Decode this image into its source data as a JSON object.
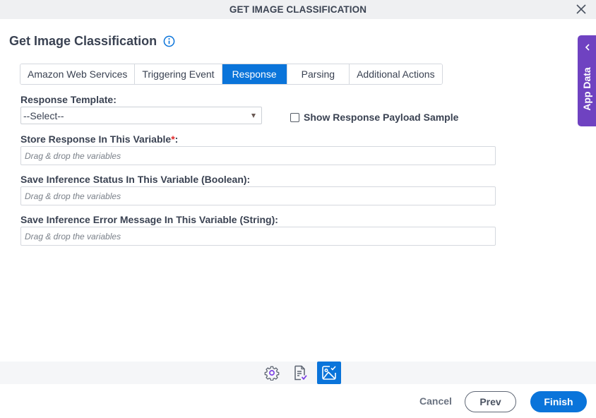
{
  "window": {
    "title": "GET IMAGE CLASSIFICATION",
    "close_icon": "close-icon"
  },
  "heading": {
    "title": "Get Image Classification",
    "info_icon": "info-circle-icon"
  },
  "tabs": [
    {
      "label": "Amazon Web Services",
      "active": false
    },
    {
      "label": "Triggering Event",
      "active": false
    },
    {
      "label": "Response",
      "active": true
    },
    {
      "label": "Parsing",
      "active": false
    },
    {
      "label": "Additional Actions",
      "active": false
    }
  ],
  "form": {
    "response_template": {
      "label": "Response Template:",
      "value": "--Select--"
    },
    "show_payload": {
      "label": "Show Response Payload Sample",
      "checked": false
    },
    "store_response": {
      "label": "Store Response In This Variable",
      "required_mark": "*",
      "suffix": ":",
      "placeholder": "Drag & drop the variables"
    },
    "inference_status": {
      "label": "Save Inference Status In This Variable (Boolean):",
      "placeholder": "Drag & drop the variables"
    },
    "inference_error": {
      "label": "Save Inference Error Message In This Variable (String):",
      "placeholder": "Drag & drop the variables"
    }
  },
  "side_panel": {
    "label": "App Data",
    "icon": "chevron-left-icon"
  },
  "icon_bar": [
    {
      "name": "settings-gear-icon",
      "active": false
    },
    {
      "name": "document-check-icon",
      "active": false
    },
    {
      "name": "image-classification-icon",
      "active": true
    }
  ],
  "footer": {
    "cancel": "Cancel",
    "prev": "Prev",
    "finish": "Finish"
  },
  "colors": {
    "accent": "#0a74da",
    "side_panel": "#6f42c1",
    "required": "#e02a2a"
  }
}
